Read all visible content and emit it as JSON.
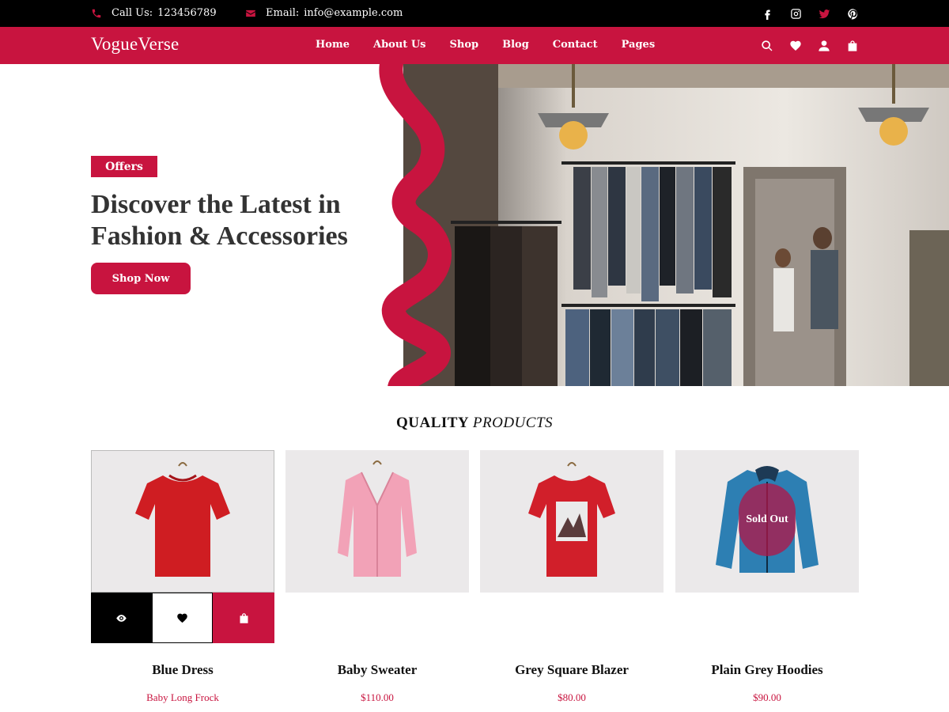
{
  "topbar": {
    "phone_label": "Call Us:",
    "phone_value": "123456789",
    "email_label": "Email:",
    "email_value": "info@example.com",
    "social_icons": [
      "facebook-icon",
      "instagram-icon",
      "twitter-icon",
      "pinterest-icon"
    ]
  },
  "nav": {
    "brand": "VogueVerse",
    "items": [
      "Home",
      "About Us",
      "Shop",
      "Blog",
      "Contact",
      "Pages"
    ],
    "icons": [
      "search-icon",
      "heart-icon",
      "user-icon",
      "bag-icon"
    ]
  },
  "hero": {
    "badge": "Offers",
    "title_line1": "Discover the Latest in",
    "title_line2": "Fashion & Accessories",
    "cta": "Shop Now"
  },
  "section": {
    "title_bold": "QUALITY",
    "title_italic": "PRODUCTS"
  },
  "products": [
    {
      "name": "Blue Dress",
      "price": "Baby Long Frock",
      "item": "red t-shirt"
    },
    {
      "name": "Baby Sweater",
      "price": "$110.00",
      "item": "pink coat"
    },
    {
      "name": "Grey Square Blazer",
      "price": "$80.00",
      "item": "red graphic t-shirt"
    },
    {
      "name": "Plain Grey Hoodies",
      "price": "$90.00",
      "item": "blue jacket",
      "badge": "Sold Out"
    }
  ],
  "colors": {
    "accent": "#c8143f",
    "topbar": "#000000",
    "card_bg": "#ebe9ea"
  }
}
